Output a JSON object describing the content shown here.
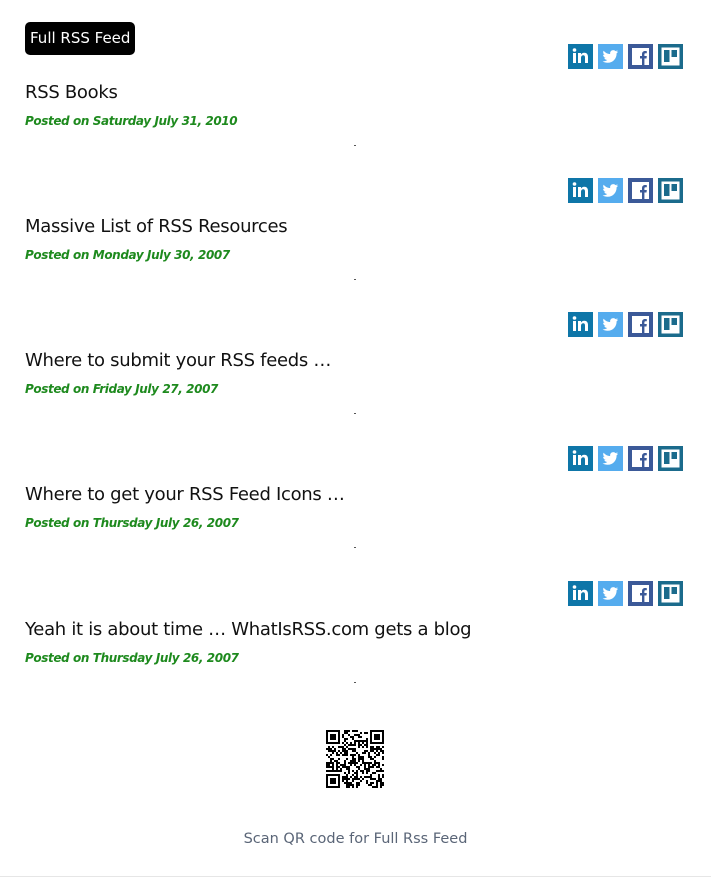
{
  "header": {
    "feed_button_label": "Full RSS Feed"
  },
  "share_icons": [
    "linkedin-icon",
    "twitter-icon",
    "facebook-icon",
    "trello-icon"
  ],
  "colors": {
    "linkedin": "#0e76a8",
    "twitter": "#55acee",
    "facebook": "#3b5998",
    "trello": "#1b6b8c",
    "posted_date": "#1e8a1e",
    "caption": "#5a6577"
  },
  "posts": [
    {
      "title": "RSS Books",
      "posted": "Posted on Saturday July 31, 2010"
    },
    {
      "title": "Massive List of RSS Resources",
      "posted": "Posted on Monday July 30, 2007"
    },
    {
      "title": "Where to submit your RSS feeds …",
      "posted": "Posted on Friday July 27, 2007"
    },
    {
      "title": "Where to get your RSS Feed Icons …",
      "posted": "Posted on Thursday July 26, 2007"
    },
    {
      "title": "Yeah it is about time … WhatIsRSS.com gets a blog",
      "posted": "Posted on Thursday July 26, 2007"
    }
  ],
  "footer": {
    "qr_caption": "Scan QR code for Full Rss Feed"
  }
}
